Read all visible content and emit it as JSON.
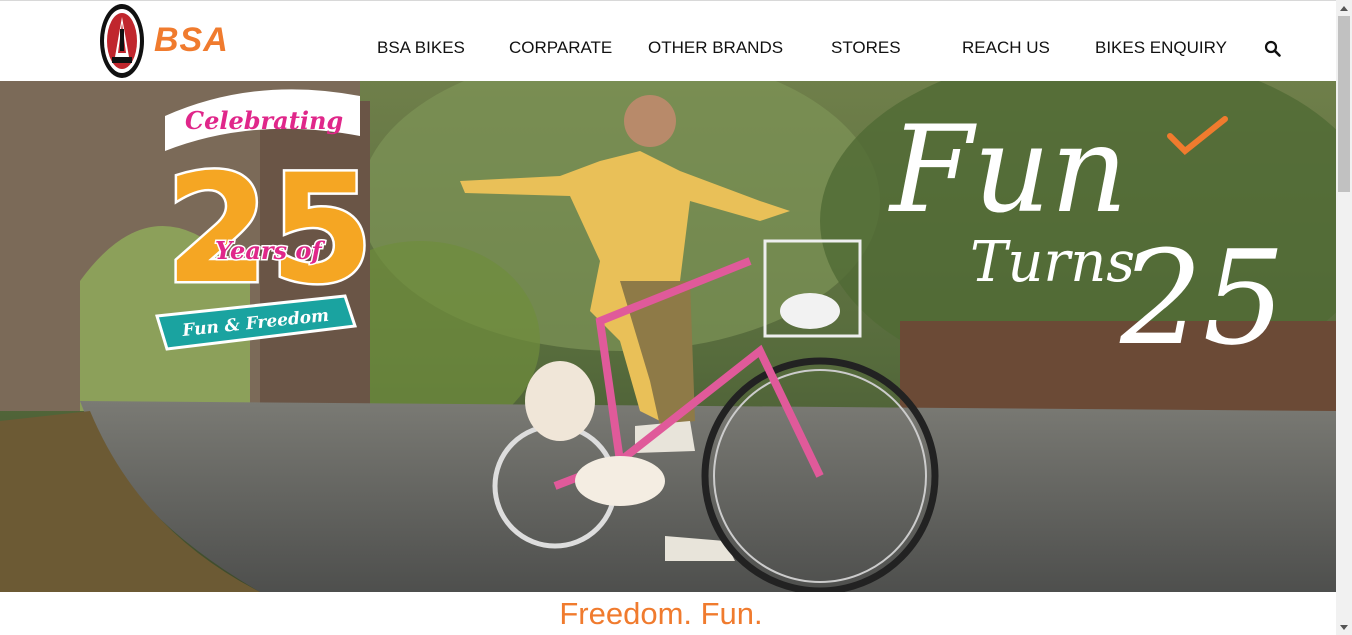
{
  "brand": {
    "logo_text": "BSA"
  },
  "nav": {
    "items": [
      {
        "label": "BSA BIKES"
      },
      {
        "label": "CORPARATE"
      },
      {
        "label": "OTHER BRANDS"
      },
      {
        "label": "STORES"
      },
      {
        "label": "REACH US"
      },
      {
        "label": "BIKES ENQUIRY"
      }
    ],
    "search_icon": "search-icon"
  },
  "hero": {
    "badge_line1": "Celebrating",
    "badge_number": "25",
    "badge_line2": "Years of",
    "badge_ribbon": "Fun & Freedom",
    "headline_1": "Fun",
    "headline_2": "Turns",
    "headline_3": "25"
  },
  "tagline": "Freedom. Fun.",
  "colors": {
    "brand_orange": "#f07b2e",
    "badge_pink": "#e0278a",
    "badge_yellow": "#f5a623",
    "ribbon_teal": "#1aa3a0"
  }
}
